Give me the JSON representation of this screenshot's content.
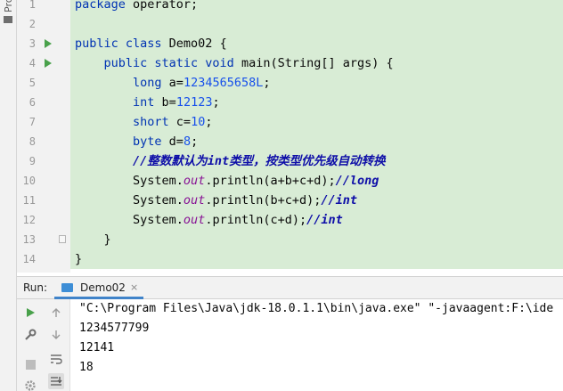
{
  "sidebar": {
    "project_tab_label": "Project"
  },
  "editor": {
    "lines": [
      {
        "n": "1",
        "tokens": [
          {
            "t": "package ",
            "c": "kw"
          },
          {
            "t": "operator;",
            "c": "plain"
          }
        ]
      },
      {
        "n": "2",
        "tokens": []
      },
      {
        "n": "3",
        "tokens": [
          {
            "t": "public class ",
            "c": "kw"
          },
          {
            "t": "Demo02 {",
            "c": "plain"
          }
        ]
      },
      {
        "n": "4",
        "tokens": [
          {
            "t": "    public static void ",
            "c": "kw"
          },
          {
            "t": "main(String[] args) {",
            "c": "plain"
          }
        ]
      },
      {
        "n": "5",
        "tokens": [
          {
            "t": "        long ",
            "c": "kw"
          },
          {
            "t": "a=",
            "c": "plain"
          },
          {
            "t": "1234565658L",
            "c": "num"
          },
          {
            "t": ";",
            "c": "plain"
          }
        ]
      },
      {
        "n": "6",
        "tokens": [
          {
            "t": "        int ",
            "c": "kw"
          },
          {
            "t": "b=",
            "c": "plain"
          },
          {
            "t": "12123",
            "c": "num"
          },
          {
            "t": ";",
            "c": "plain"
          }
        ]
      },
      {
        "n": "7",
        "tokens": [
          {
            "t": "        short ",
            "c": "kw"
          },
          {
            "t": "c=",
            "c": "plain"
          },
          {
            "t": "10",
            "c": "num"
          },
          {
            "t": ";",
            "c": "plain"
          }
        ]
      },
      {
        "n": "8",
        "tokens": [
          {
            "t": "        byte ",
            "c": "kw"
          },
          {
            "t": "d=",
            "c": "plain"
          },
          {
            "t": "8",
            "c": "num"
          },
          {
            "t": ";",
            "c": "plain"
          }
        ]
      },
      {
        "n": "9",
        "tokens": [
          {
            "t": "        //整数默认为int类型，按类型优先级自动转换",
            "c": "cmt"
          }
        ]
      },
      {
        "n": "10",
        "tokens": [
          {
            "t": "        System.",
            "c": "plain"
          },
          {
            "t": "out",
            "c": "fld"
          },
          {
            "t": ".println(a+b+c+d);",
            "c": "plain"
          },
          {
            "t": "//long",
            "c": "cmt"
          }
        ]
      },
      {
        "n": "11",
        "tokens": [
          {
            "t": "        System.",
            "c": "plain"
          },
          {
            "t": "out",
            "c": "fld"
          },
          {
            "t": ".println(b+c+d);",
            "c": "plain"
          },
          {
            "t": "//int",
            "c": "cmt"
          }
        ]
      },
      {
        "n": "12",
        "tokens": [
          {
            "t": "        System.",
            "c": "plain"
          },
          {
            "t": "out",
            "c": "fld"
          },
          {
            "t": ".println(c+d);",
            "c": "plain"
          },
          {
            "t": "//int",
            "c": "cmt"
          }
        ]
      },
      {
        "n": "13",
        "tokens": [
          {
            "t": "    }",
            "c": "plain"
          }
        ]
      },
      {
        "n": "14",
        "tokens": [
          {
            "t": "}",
            "c": "plain"
          }
        ]
      }
    ],
    "run_gutter_lines": [
      "3",
      "4"
    ],
    "fold_gutter_lines": [
      "13"
    ]
  },
  "run_panel": {
    "label": "Run:",
    "tab_label": "Demo02",
    "tab_close": "×",
    "console_lines": [
      "\"C:\\Program Files\\Java\\jdk-18.0.1.1\\bin\\java.exe\" \"-javaagent:F:\\ide",
      "1234577799",
      "12141",
      "18"
    ]
  },
  "icons": {
    "rerun": "rerun-icon",
    "scroll_up": "arrow-up-icon",
    "wrench": "wrench-icon",
    "scroll_down": "arrow-down-icon",
    "stop": "stop-icon",
    "soft_wrap": "soft-wrap-icon",
    "settings": "gear-icon",
    "scroll_end": "scroll-to-end-icon"
  },
  "colors": {
    "code_bg": "#d8ecd5",
    "keyword": "#0033b3",
    "number": "#1750eb",
    "field": "#871094",
    "comment": "#0e0ea8",
    "run_green": "#49a14b",
    "tab_underline": "#4083c9"
  }
}
